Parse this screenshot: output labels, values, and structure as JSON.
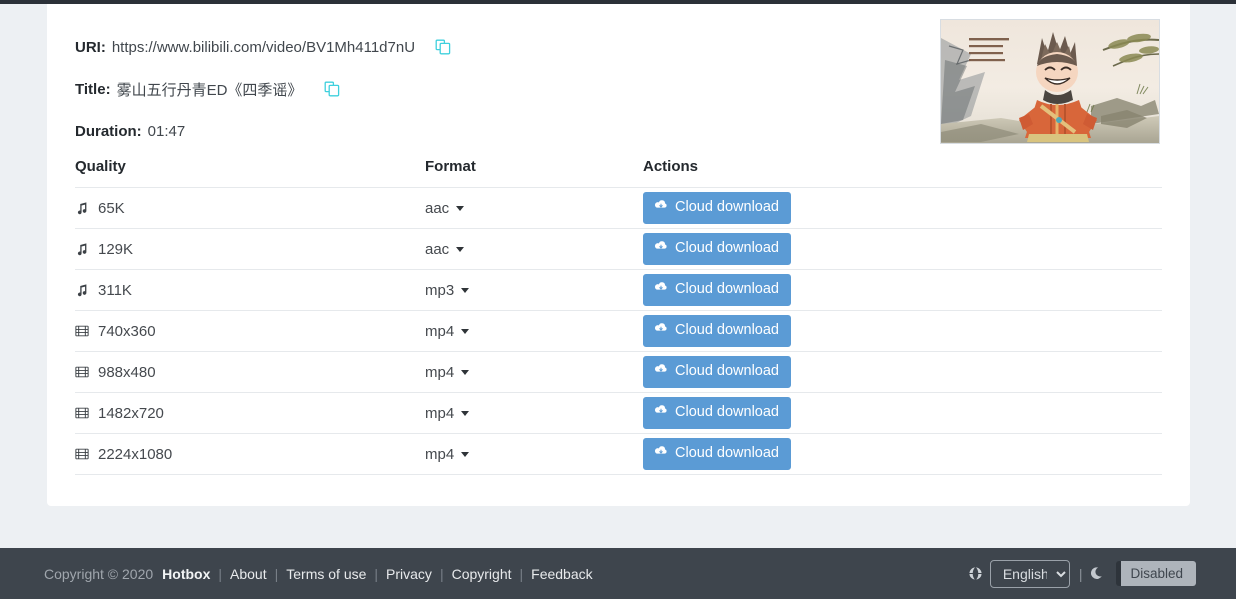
{
  "meta": {
    "uri_label": "URI:",
    "uri_value": "https://www.bilibili.com/video/BV1Mh411d7nU",
    "title_label": "Title:",
    "title_value": "雾山五行丹青ED《四季谣》",
    "duration_label": "Duration:",
    "duration_value": "01:47",
    "copy_icon": "copy-icon"
  },
  "thumbnail": {
    "alt": "video-thumbnail",
    "credits": [
      "片尾曲《四季谣》",
      "作曲   严非洋",
      "作词   李业琳",
      "演唱   啦啦叶子"
    ]
  },
  "table": {
    "headers": [
      "Quality",
      "Format",
      "Actions"
    ],
    "rows": [
      {
        "icon": "music-note-icon",
        "quality": "65K",
        "format": "aac",
        "action": "Cloud download"
      },
      {
        "icon": "music-note-icon",
        "quality": "129K",
        "format": "aac",
        "action": "Cloud download"
      },
      {
        "icon": "music-note-icon",
        "quality": "311K",
        "format": "mp3",
        "action": "Cloud download"
      },
      {
        "icon": "film-icon",
        "quality": "740x360",
        "format": "mp4",
        "action": "Cloud download"
      },
      {
        "icon": "film-icon",
        "quality": "988x480",
        "format": "mp4",
        "action": "Cloud download"
      },
      {
        "icon": "film-icon",
        "quality": "1482x720",
        "format": "mp4",
        "action": "Cloud download"
      },
      {
        "icon": "film-icon",
        "quality": "2224x1080",
        "format": "mp4",
        "action": "Cloud download"
      }
    ],
    "action_icon": "cloud-download-icon"
  },
  "footer": {
    "copyright": "Copyright © 2020",
    "brand": "Hotbox",
    "links": [
      "About",
      "Terms of use",
      "Privacy",
      "Copyright",
      "Feedback"
    ],
    "separator": "|",
    "globe_icon": "globe-icon",
    "language": {
      "selected": "English",
      "options": [
        "English"
      ]
    },
    "moon_icon": "moon-icon",
    "theme_toggle": "Disabled"
  },
  "colors": {
    "accent_blue": "#5b9bd5",
    "copy_cyan": "#3fd0dd",
    "footer_bg": "#3e454d",
    "page_bg": "#edf0f3",
    "card_bg": "#ffffff"
  }
}
